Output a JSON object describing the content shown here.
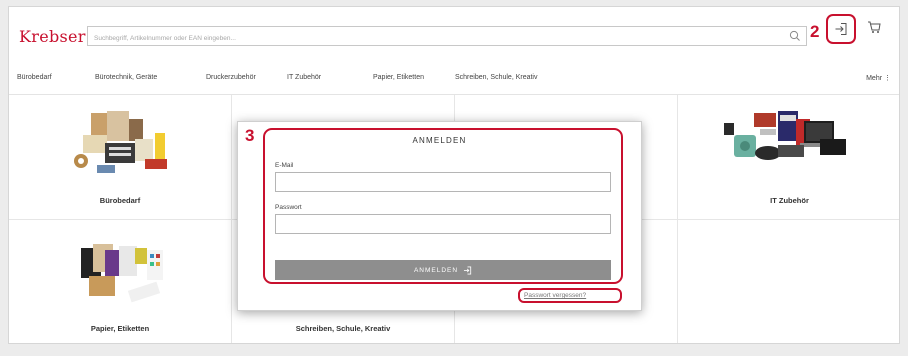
{
  "header": {
    "logo": "Krebser",
    "search_placeholder": "Suchbegriff, Artikelnummer oder EAN eingeben...",
    "callout_login": "2"
  },
  "nav": {
    "items": [
      "Bürobedarf",
      "Bürotechnik, Geräte",
      "Druckerzubehör",
      "IT Zubehör",
      "Papier, Etiketten",
      "Schreiben, Schule, Kreativ"
    ],
    "more": "Mehr"
  },
  "categories": [
    {
      "label": "Bürobedarf"
    },
    {
      "label": "IT Zubehör"
    },
    {
      "label": "Papier, Etiketten"
    },
    {
      "label": "Schreiben, Schule, Kreativ"
    }
  ],
  "modal": {
    "callout": "3",
    "title": "ANMELDEN",
    "email_label": "E-Mail",
    "password_label": "Passwort",
    "submit_label": "ANMELDEN",
    "forgot_label": "Passwort vergessen?"
  },
  "colors": {
    "brand": "#c8102e",
    "button": "#8e8e8e"
  }
}
